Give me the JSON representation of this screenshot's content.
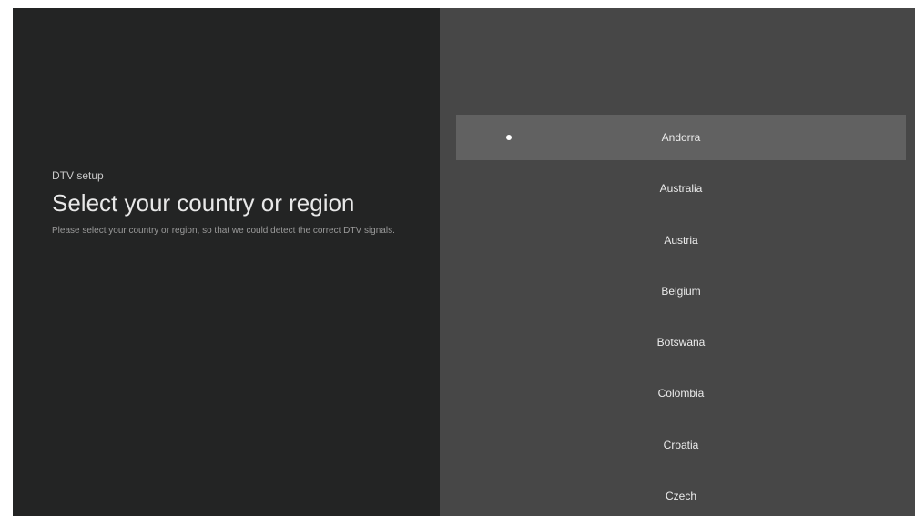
{
  "left_panel": {
    "eyebrow": "DTV setup",
    "title": "Select your country or region",
    "description": "Please select your country or region, so that we could detect the correct DTV signals."
  },
  "country_list": {
    "selected_index": 0,
    "items": [
      {
        "label": "Andorra"
      },
      {
        "label": "Australia"
      },
      {
        "label": "Austria"
      },
      {
        "label": "Belgium"
      },
      {
        "label": "Botswana"
      },
      {
        "label": "Colombia"
      },
      {
        "label": "Croatia"
      },
      {
        "label": "Czech"
      }
    ]
  },
  "colors": {
    "left_background": "#232424",
    "right_background": "#474747",
    "selected_background": "#616161",
    "text_primary": "#ececec"
  }
}
